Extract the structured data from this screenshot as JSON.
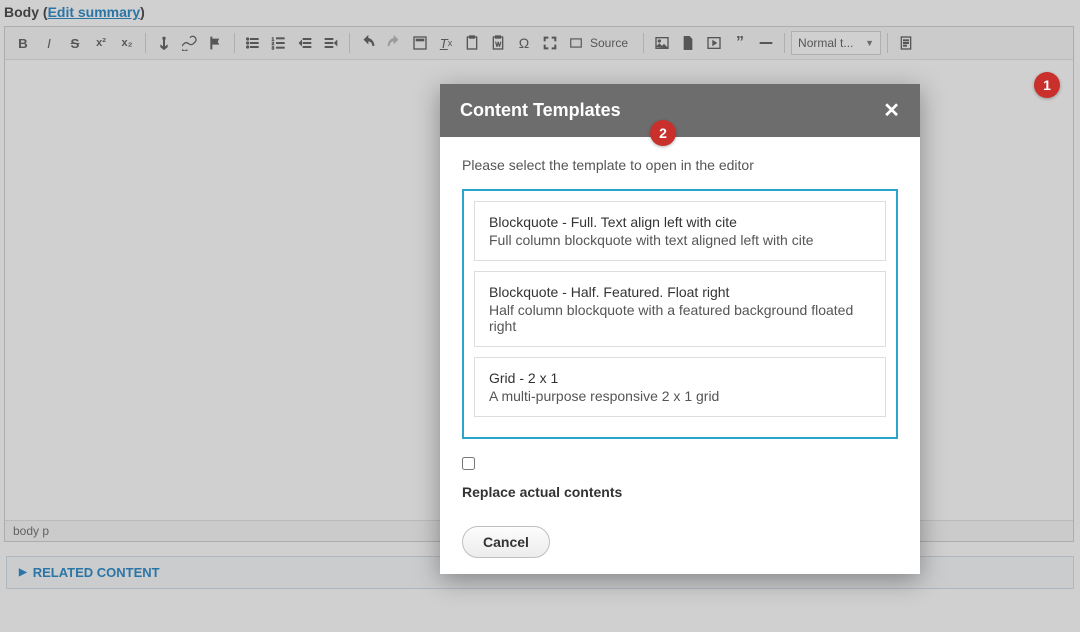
{
  "field": {
    "label": "Body",
    "summary_link": "Edit summary"
  },
  "toolbar": {
    "source": "Source",
    "text_style": "Normal t..."
  },
  "editor": {
    "path": "body   p"
  },
  "related": {
    "label": "RELATED CONTENT"
  },
  "dialog": {
    "title": "Content Templates",
    "message": "Please select the template to open in the editor",
    "templates": [
      {
        "title": "Blockquote - Full. Text align left with cite",
        "desc": "Full column blockquote with text aligned left with cite"
      },
      {
        "title": "Blockquote - Half. Featured. Float right",
        "desc": "Half column blockquote with a featured background floated right"
      },
      {
        "title": "Grid - 2 x 1",
        "desc": "A multi-purpose responsive 2 x 1 grid"
      }
    ],
    "replace_label": "Replace actual contents",
    "cancel": "Cancel"
  },
  "badges": {
    "1": "1",
    "2": "2"
  }
}
